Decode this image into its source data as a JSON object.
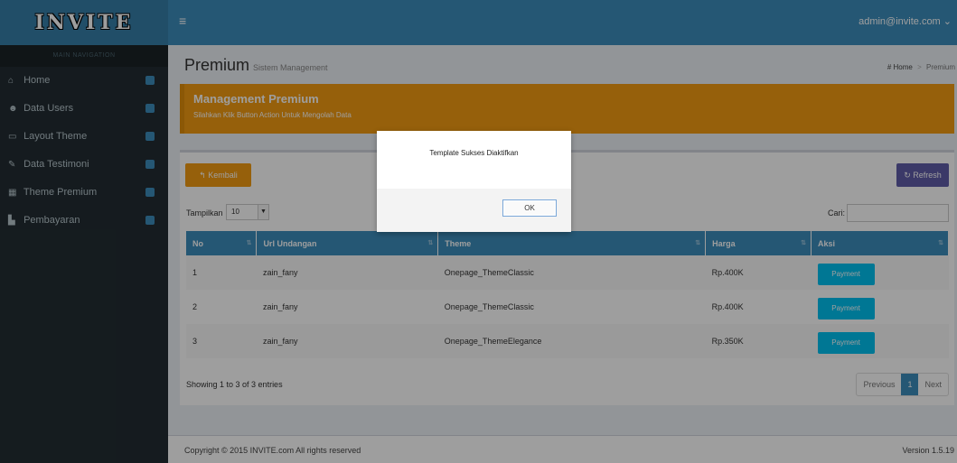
{
  "app": {
    "logo": "INVITE",
    "user": "admin@invite.com ⌄",
    "menu_icon": "≡"
  },
  "colors": {
    "primary": "#3c8dbc",
    "warning": "#f39c12",
    "purple": "#605ca8",
    "info": "#00c0ef",
    "sidebar": "#222d32"
  },
  "sidebar": {
    "header": "MAIN NAVIGATION",
    "items": [
      {
        "label": "Home",
        "icon": "home-icon",
        "glyph": "⌂",
        "badge": ""
      },
      {
        "label": "Data Users",
        "icon": "users-icon",
        "glyph": "☻",
        "badge": ""
      },
      {
        "label": "Layout Theme",
        "icon": "monitor-icon",
        "glyph": "▭",
        "badge": ""
      },
      {
        "label": "Data Testimoni",
        "icon": "edit-icon",
        "glyph": "✎",
        "badge": ""
      },
      {
        "label": "Theme Premium",
        "icon": "table-icon",
        "glyph": "▦",
        "badge": ""
      },
      {
        "label": "Pembayaran",
        "icon": "building-icon",
        "glyph": "▙",
        "badge": ""
      }
    ]
  },
  "header": {
    "title": "Premium",
    "subtitle": "Sistem Management"
  },
  "breadcrumb": {
    "home": "Home",
    "current": "Premium",
    "home_icon": "#",
    "sep": ">"
  },
  "callout": {
    "title": "Management Premium",
    "text": "Silahkan Klik Button Action Untuk Mengolah Data"
  },
  "toolbar": {
    "back_label": "↰ Kembali",
    "refresh_label": "↻ Refresh"
  },
  "datatable": {
    "length_label": "Tampilkan",
    "length_value": "10",
    "search_label": "Cari:",
    "search_value": "",
    "columns": [
      "No",
      "Url Undangan",
      "Theme",
      "Harga",
      "Aksi"
    ],
    "rows": [
      {
        "no": "1",
        "url": "zain_fany",
        "theme": "Onepage_ThemeClassic",
        "harga": "Rp.400K",
        "aksi": "Payment"
      },
      {
        "no": "2",
        "url": "zain_fany",
        "theme": "Onepage_ThemeClassic",
        "harga": "Rp.400K",
        "aksi": "Payment"
      },
      {
        "no": "3",
        "url": "zain_fany",
        "theme": "Onepage_ThemeElegance",
        "harga": "Rp.350K",
        "aksi": "Payment"
      }
    ],
    "info": "Showing 1 to 3 of 3 entries",
    "pager": {
      "prev": "Previous",
      "current": "1",
      "next": "Next"
    }
  },
  "footer": {
    "copyright": "Copyright © 2015 INVITE.com All rights reserved",
    "version": "Version 1.5.19"
  },
  "modal": {
    "message": "Template Sukses Diaktifkan",
    "ok_label": "OK"
  }
}
